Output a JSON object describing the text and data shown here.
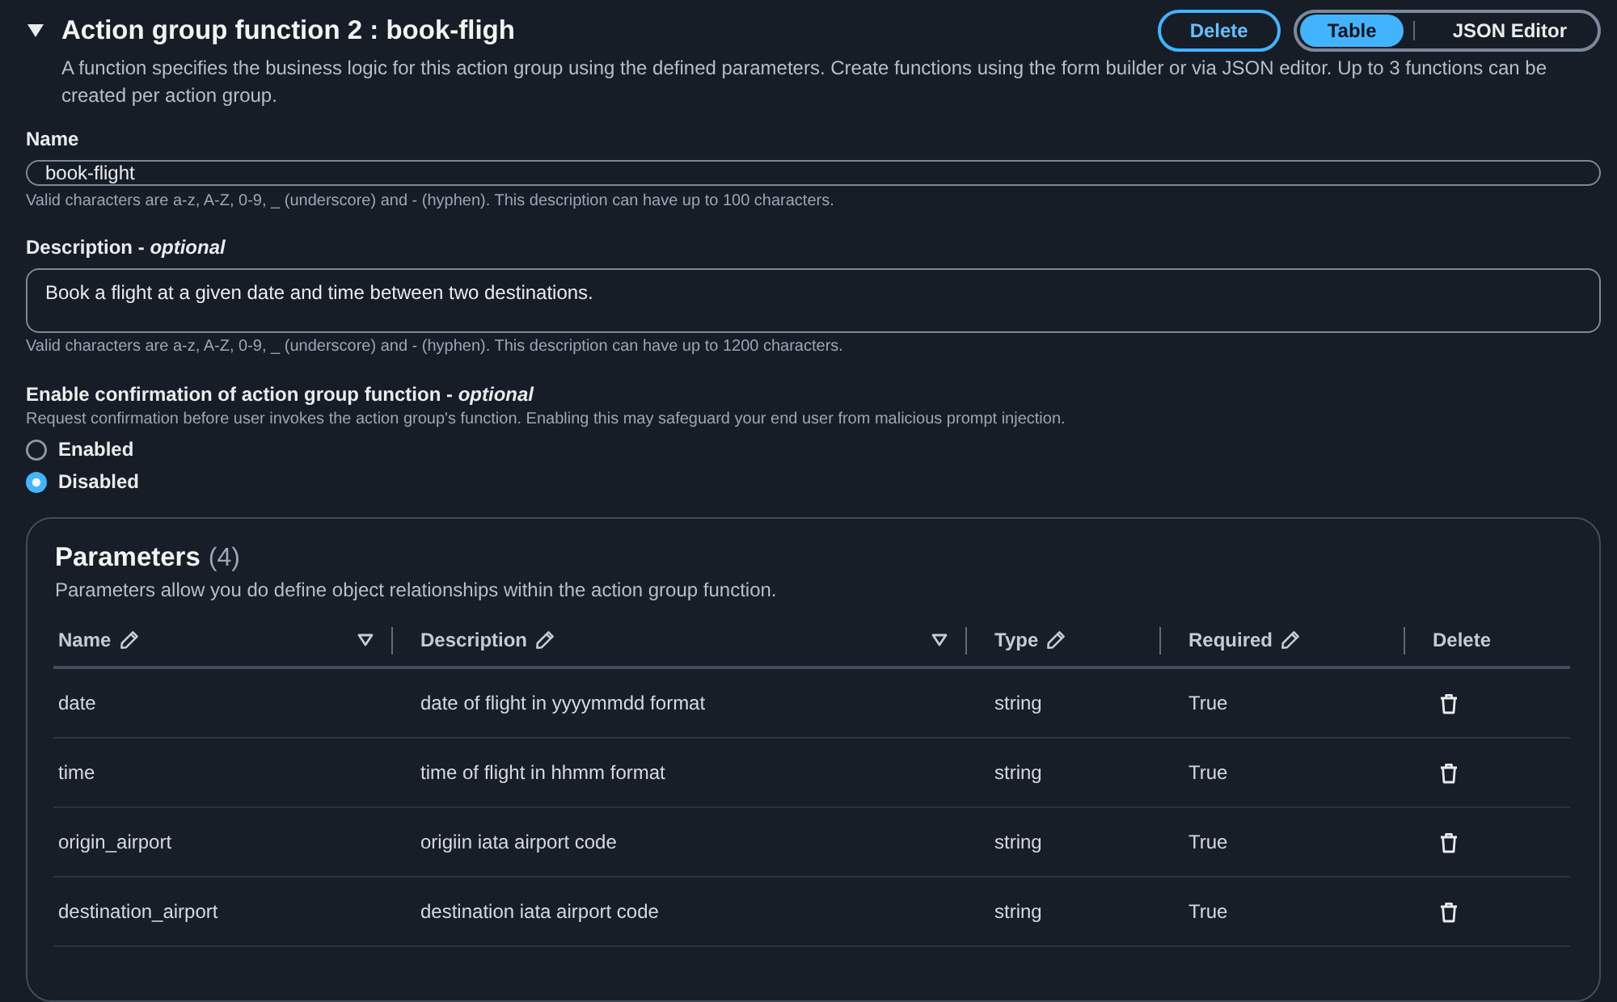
{
  "section": {
    "expanded": true,
    "title": "Action group function 2 : book-fligh",
    "description": "A function specifies the business logic for this action group using the defined parameters. Create functions using the form builder or via JSON editor. Up to 3 functions can be created per action group.",
    "delete_button": "Delete",
    "view_toggle": [
      {
        "label": "Table",
        "selected": true
      },
      {
        "label": "JSON Editor",
        "selected": false
      }
    ]
  },
  "name_field": {
    "label": "Name",
    "value": "book-flight",
    "hint": "Valid characters are a-z, A-Z, 0-9, _ (underscore) and - (hyphen). This description can have up to 100 characters."
  },
  "description_field": {
    "label": "Description - *optional*",
    "value": "Book a flight at a given date and time between two destinations.",
    "hint": "Valid characters are a-z, A-Z, 0-9, _ (underscore) and - (hyphen). This description can have up to 1200 characters."
  },
  "confirmation": {
    "label": "Enable confirmation of action group function - *optional*",
    "hint": "Request confirmation before user invokes the action group's function. Enabling this may safeguard your end user from malicious prompt injection.",
    "options": [
      {
        "label": "Enabled",
        "selected": false
      },
      {
        "label": "Disabled",
        "selected": true
      }
    ]
  },
  "parameters": {
    "title": "Parameters",
    "count": "(4)",
    "description": "Parameters allow you do define object relationships within the action group function.",
    "columns": [
      {
        "label": "Name",
        "kind": "text",
        "editable": true,
        "sortable": true
      },
      {
        "label": "Description",
        "kind": "text",
        "editable": true,
        "sortable": true
      },
      {
        "label": "Type",
        "kind": "text",
        "editable": true,
        "sortable": false
      },
      {
        "label": "Required",
        "kind": "text",
        "editable": true,
        "sortable": false
      },
      {
        "label": "Delete",
        "kind": "action",
        "editable": false,
        "sortable": false
      }
    ],
    "rows": [
      {
        "cells": [
          "date",
          "date of flight in yyyymmdd format",
          "string",
          "True"
        ]
      },
      {
        "cells": [
          "time",
          "time of flight in hhmm format",
          "string",
          "True"
        ]
      },
      {
        "cells": [
          "origin_airport",
          "origiin iata airport code",
          "string",
          "True"
        ]
      },
      {
        "cells": [
          "destination_airport",
          "destination iata airport code",
          "string",
          "True"
        ]
      }
    ]
  }
}
